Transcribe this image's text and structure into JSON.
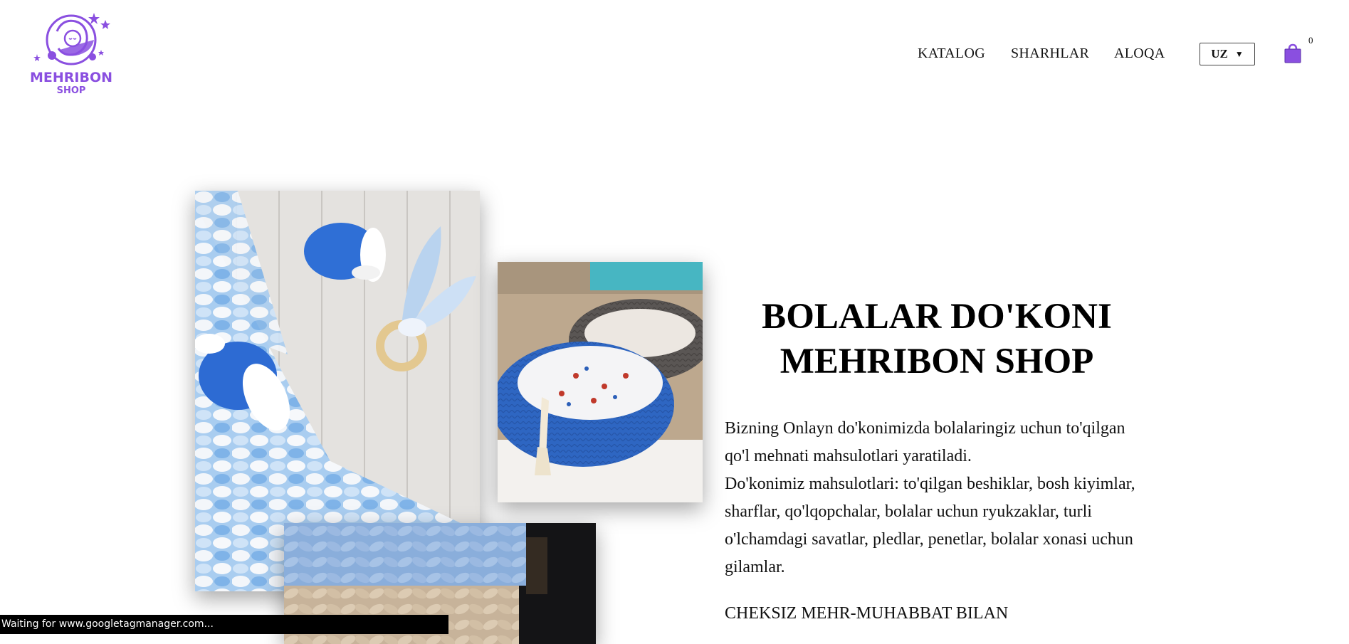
{
  "brand": {
    "name": "MEHRIBON",
    "sub": "SHOP"
  },
  "nav": {
    "items": [
      "KATALOG",
      "SHARHLAR",
      "ALOQA"
    ]
  },
  "language": {
    "selected": "UZ"
  },
  "cart": {
    "count": "0",
    "icon": "shopping-bag-icon"
  },
  "hero": {
    "title_line1": "BOLALAR DO'KONI",
    "title_line2": "MEHRIBON SHOP",
    "paragraph_line1": "Bizning Onlayn do'konimizda bolalaringiz uchun to'qilgan qo'l mehnati mahsulotlari yaratiladi.",
    "paragraph_line2": "Do'konimiz mahsulotlari: to'qilgan beshiklar, bosh kiyimlar, sharflar, qo'lqopchalar, bolalar uchun ryukzaklar, turli o'lchamdagi savatlar, pledlar, penetlar, bolalar xonasi uchun gilamlar.",
    "tagline": "CHEKSIZ MEHR-MUHABBAT BILAN"
  },
  "status_bar": {
    "text": "Waiting for www.googletagmanager.com..."
  },
  "colors": {
    "brand": "#8a4fe0",
    "text": "#111111",
    "background": "#ffffff"
  }
}
